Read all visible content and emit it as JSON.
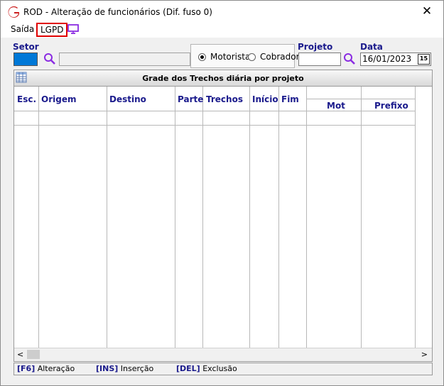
{
  "window": {
    "title": "ROD - Alteração de funcionários (Dif. fuso 0)",
    "close_glyph": "✕"
  },
  "menu": {
    "saida": "Saída",
    "lgpd": "LGPD",
    "monitor_icon": "monitor-icon"
  },
  "filters": {
    "setor_label": "Setor",
    "setor_code": "",
    "setor_name": "",
    "radio_motorista": "Motorista",
    "radio_cobrador": "Cobrador",
    "radio_selected": "Motorista",
    "projeto_label": "Projeto",
    "projeto_value": "",
    "data_label": "Data",
    "data_value": "16/01/2023",
    "calendar_glyph": "15"
  },
  "grid": {
    "title": "Grade dos Trechos diária por projeto",
    "columns": [
      "Esc.",
      "Origem",
      "Destino",
      "Parte",
      "Trechos",
      "Início",
      "Fim",
      "Mot",
      "Prefixo"
    ],
    "rows": []
  },
  "status": {
    "f6_key": "[F6]",
    "f6_label": " Alteração",
    "ins_key": "[INS]",
    "ins_label": " Inserção",
    "del_key": "[DEL]",
    "del_label": " Exclusão"
  },
  "colors": {
    "accent_blue": "#0078d7",
    "label_navy": "#1a1a8c",
    "lgpd_border": "#e00000",
    "icon_purple": "#8a2be2"
  }
}
